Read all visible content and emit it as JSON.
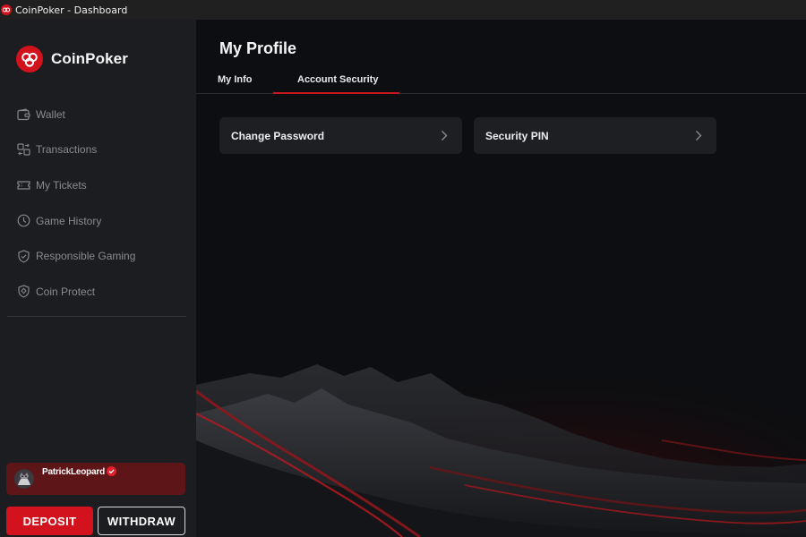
{
  "window": {
    "title": "CoinPoker - Dashboard"
  },
  "brand": {
    "name": "CoinPoker",
    "accent_color": "#d2121d"
  },
  "sidebar": {
    "items": [
      {
        "label": "Wallet",
        "icon": "wallet-icon"
      },
      {
        "label": "Transactions",
        "icon": "transactions-icon"
      },
      {
        "label": "My Tickets",
        "icon": "ticket-icon"
      },
      {
        "label": "Game History",
        "icon": "clock-icon"
      },
      {
        "label": "Responsible Gaming",
        "icon": "shield-check-icon"
      },
      {
        "label": "Coin Protect",
        "icon": "shield-coin-icon"
      }
    ]
  },
  "user": {
    "name": "PatrickLeopard",
    "verified": true
  },
  "actions": {
    "deposit_label": "DEPOSIT",
    "withdraw_label": "WITHDRAW"
  },
  "main": {
    "page_title": "My Profile",
    "tabs": [
      {
        "label": "My Info",
        "active": false
      },
      {
        "label": "Account Security",
        "active": true
      }
    ],
    "cards": [
      {
        "label": "Change Password",
        "icon": "chevron-right-icon"
      },
      {
        "label": "Security PIN",
        "icon": "chevron-right-icon"
      }
    ]
  }
}
